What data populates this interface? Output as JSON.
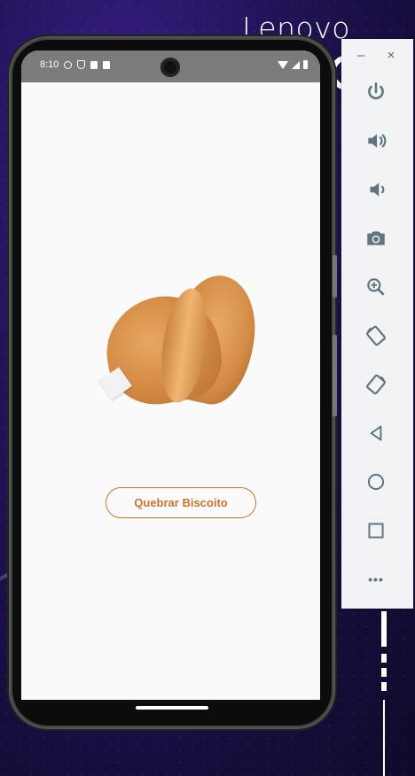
{
  "background": {
    "brand_text": "Lenovo"
  },
  "emulator_panel": {
    "minimize_label": "–",
    "close_label": "×",
    "tools": [
      {
        "name": "power",
        "icon": "power-icon"
      },
      {
        "name": "volume-up",
        "icon": "volume-up-icon"
      },
      {
        "name": "volume-down",
        "icon": "volume-down-icon"
      },
      {
        "name": "screenshot",
        "icon": "camera-icon"
      },
      {
        "name": "zoom",
        "icon": "zoom-in-icon"
      },
      {
        "name": "rotate-left",
        "icon": "rotate-left-icon"
      },
      {
        "name": "rotate-right",
        "icon": "rotate-right-icon"
      },
      {
        "name": "back",
        "icon": "back-triangle-icon"
      },
      {
        "name": "home",
        "icon": "home-circle-icon"
      },
      {
        "name": "overview",
        "icon": "overview-square-icon"
      },
      {
        "name": "more",
        "icon": "more-dots-icon"
      }
    ],
    "more_label": "•••"
  },
  "device": {
    "status_bar": {
      "time": "8:10"
    },
    "app": {
      "image": {
        "icon": "fortune-cookie-image"
      },
      "button_label": "Quebrar Biscoito",
      "accent_color": "#c7752a"
    }
  }
}
